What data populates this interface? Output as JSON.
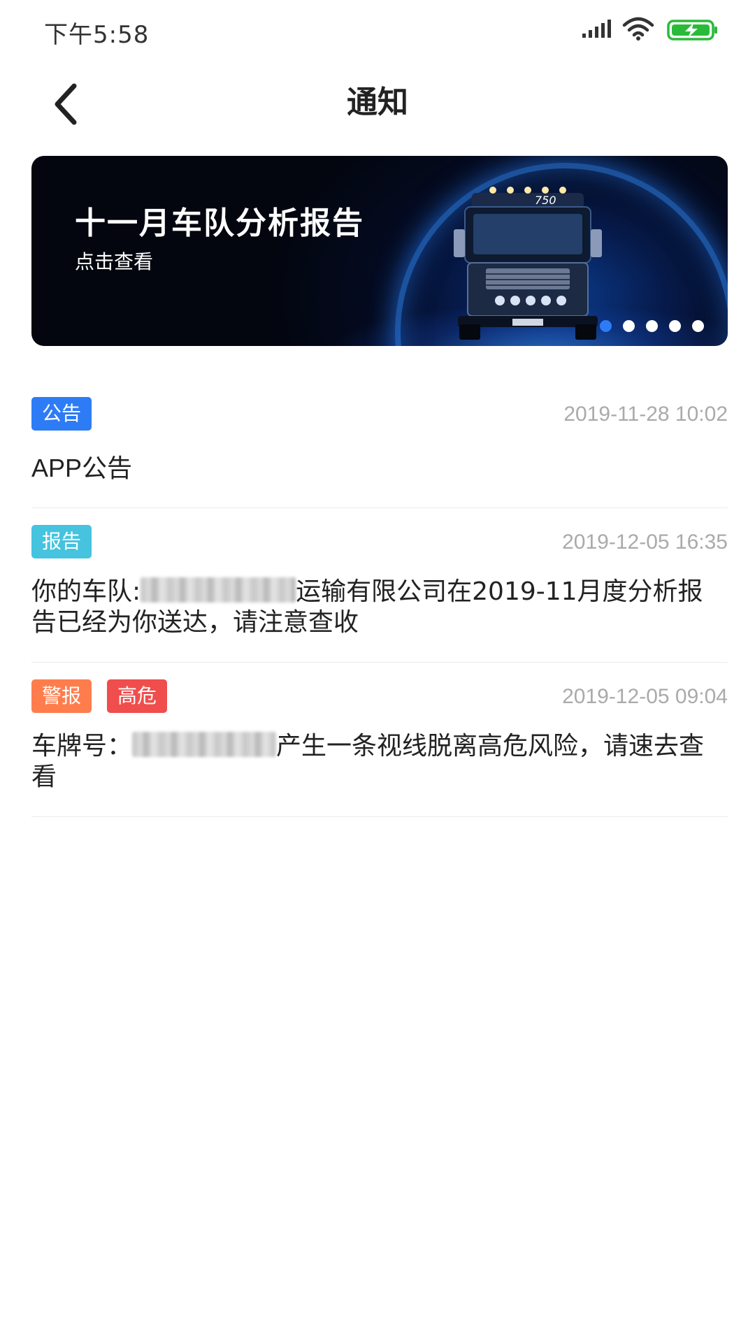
{
  "status_bar": {
    "time": "下午5:58",
    "icons": [
      "signal-icon",
      "wifi-icon",
      "battery-charging-icon"
    ]
  },
  "header": {
    "title": "通知",
    "back_icon": "chevron-left-icon"
  },
  "banner": {
    "title": "十一月车队分析报告",
    "subtitle": "点击查看",
    "truck_badge": "750",
    "dots": {
      "count": 5,
      "active_index": 0
    },
    "accent_color": "#2d7cf6"
  },
  "notifications": [
    {
      "tags": [
        {
          "label": "公告",
          "color": "#2d7cf6"
        }
      ],
      "time": "2019-11-28 10:02",
      "body_parts": [
        "APP公告"
      ]
    },
    {
      "tags": [
        {
          "label": "报告",
          "color": "#46c3de"
        }
      ],
      "time": "2019-12-05 16:35",
      "body_prefix": "你的车队:",
      "body_suffix": "运输有限公司在2019-11月度分析报告已经为你送达，请注意查收"
    },
    {
      "tags": [
        {
          "label": "警报",
          "color": "#ff7d4d"
        },
        {
          "label": "高危",
          "color": "#f04d4d"
        }
      ],
      "time": "2019-12-05 09:04",
      "body_prefix": "车牌号：",
      "body_suffix": "产生一条视线脱离高危风险，请速去查看"
    }
  ]
}
